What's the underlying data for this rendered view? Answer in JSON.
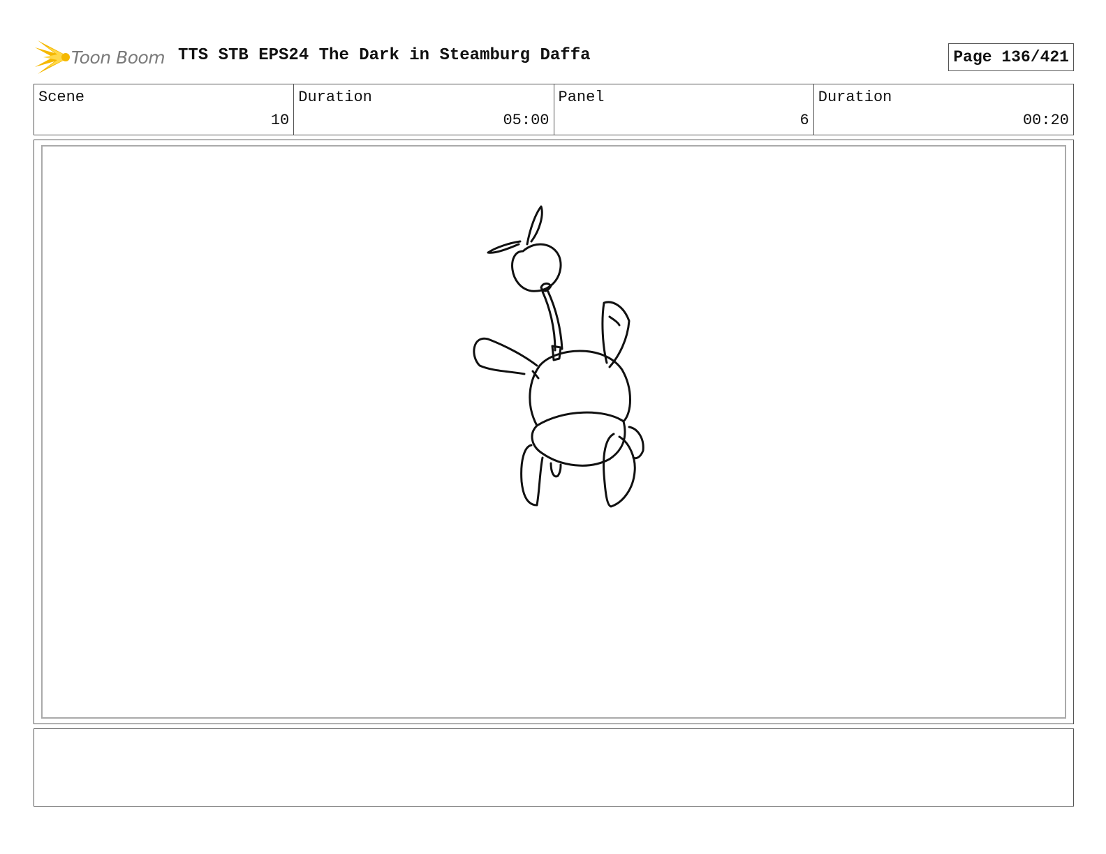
{
  "header": {
    "logo_text": "Toon Boom",
    "title": "TTS STB EPS24 The Dark in Steamburg Daffa",
    "page_label": "Page 136/421"
  },
  "info": {
    "scene_label": "Scene",
    "scene_value": "10",
    "scene_duration_label": "Duration",
    "scene_duration_value": "05:00",
    "panel_label": "Panel",
    "panel_value": "6",
    "panel_duration_label": "Duration",
    "panel_duration_value": "00:20"
  },
  "colors": {
    "logo_burst": "#f5b800",
    "logo_text": "#7a7a7a",
    "border": "#555555",
    "panel_inner_border": "#aaaaaa"
  }
}
